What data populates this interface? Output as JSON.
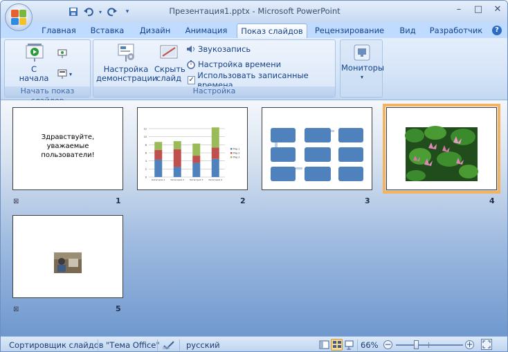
{
  "window": {
    "title": "Презентация1.pptx - Microsoft PowerPoint",
    "controls": [
      "–",
      "□",
      "✕"
    ]
  },
  "qat": {
    "save": "save-icon",
    "undo": "undo-icon",
    "redo": "redo-icon"
  },
  "tabs": [
    {
      "label": "Главная"
    },
    {
      "label": "Вставка"
    },
    {
      "label": "Дизайн"
    },
    {
      "label": "Анимация"
    },
    {
      "label": "Показ слайдов",
      "active": true
    },
    {
      "label": "Рецензирование"
    },
    {
      "label": "Вид"
    },
    {
      "label": "Разработчик"
    }
  ],
  "ribbon": {
    "start_group": {
      "label": "Начать показ слайдов",
      "from_start": [
        "С",
        "начала"
      ]
    },
    "setup_group": {
      "label": "Настройка",
      "setup_show": [
        "Настройка",
        "демонстрации"
      ],
      "hide_slide": [
        "Скрыть",
        "слайд"
      ],
      "record": "Звукозапись",
      "rehearse": "Настройка времени",
      "use_timings": "Использовать записанные времена",
      "use_timings_checked": true
    },
    "monitors_group": {
      "label": "Мониторы"
    }
  },
  "slides": [
    {
      "num": "1",
      "text": "Здравствуйте, уважаемые пользователи!",
      "has_transition_icon": true
    },
    {
      "num": "2",
      "has_transition_icon": false
    },
    {
      "num": "3",
      "has_transition_icon": false
    },
    {
      "num": "4",
      "has_transition_icon": false,
      "selected": true
    },
    {
      "num": "5",
      "has_transition_icon": true
    }
  ],
  "chart_data": {
    "type": "bar",
    "categories": [
      "Категория 1",
      "Категория 2",
      "Категория 3",
      "Категория 4"
    ],
    "series": [
      {
        "name": "Ряд 1",
        "values": [
          4.3,
          2.5,
          3.5,
          4.5
        ],
        "color": "#4f81bd"
      },
      {
        "name": "Ряд 2",
        "values": [
          2.4,
          4.4,
          1.8,
          2.8
        ],
        "color": "#c0504d"
      },
      {
        "name": "Ряд 3",
        "values": [
          2,
          2,
          3,
          5
        ],
        "color": "#9bbb59"
      }
    ],
    "ylim": [
      0,
      12
    ],
    "yticks": [
      "0",
      "2",
      "4",
      "6",
      "8",
      "10",
      "12"
    ],
    "legend": "right",
    "grid": true
  },
  "status": {
    "view_name": "Сортировщик слайдов",
    "theme": "\"Тема Office\"",
    "language": "русский",
    "zoom": "66%",
    "zoom_fraction": 0.66
  }
}
